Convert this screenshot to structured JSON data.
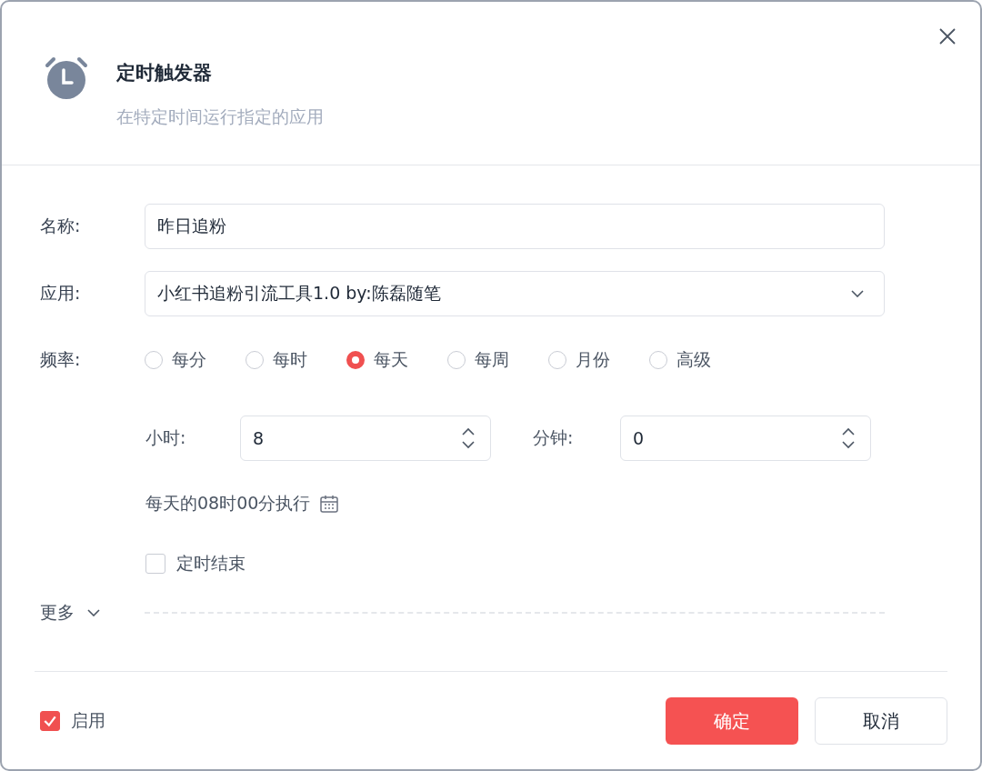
{
  "dialog": {
    "title": "定时触发器",
    "subtitle": "在特定时间运行指定的应用"
  },
  "fields": [
    {
      "label": "名称:",
      "value": "昨日追粉",
      "kind": "text"
    },
    {
      "label": "应用:",
      "value": "小红书追粉引流工具1.0 by:陈磊随笔",
      "kind": "select"
    }
  ],
  "frequency": {
    "label": "频率:",
    "options": [
      {
        "label": "每分",
        "selected": false
      },
      {
        "label": "每时",
        "selected": false
      },
      {
        "label": "每天",
        "selected": true
      },
      {
        "label": "每周",
        "selected": false
      },
      {
        "label": "月份",
        "selected": false
      },
      {
        "label": "高级",
        "selected": false
      }
    ]
  },
  "time": [
    {
      "label": "小时:",
      "value": "8"
    },
    {
      "label": "分钟:",
      "value": "0"
    }
  ],
  "summary": "每天的08时00分执行",
  "end_timer": {
    "label": "定时结束",
    "checked": false
  },
  "more": {
    "label": "更多"
  },
  "enabled": {
    "label": "启用",
    "checked": true
  },
  "buttons": [
    {
      "label": "确定",
      "kind": "primary"
    },
    {
      "label": "取消",
      "kind": "secondary"
    }
  ]
}
